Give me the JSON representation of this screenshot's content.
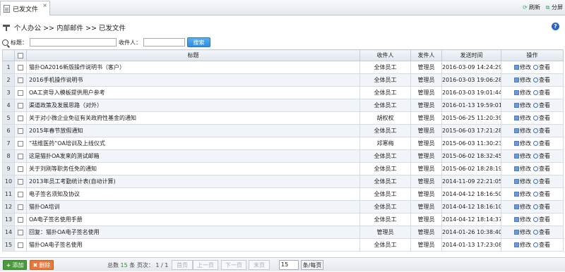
{
  "tab": {
    "title": "已发文件",
    "close": "×"
  },
  "top_actions": {
    "refresh": "刷新",
    "split": "分屏"
  },
  "breadcrumb": "个人办公 >> 内部邮件 >> 已发文件",
  "help": "?",
  "search": {
    "title_label": "标题：",
    "receiver_label": "收件人：",
    "button": "搜索",
    "title_value": "",
    "receiver_value": ""
  },
  "columns": {
    "title": "标题",
    "receiver": "收件人",
    "sender": "发件人",
    "time": "发送时间",
    "ops": "操作"
  },
  "ops": {
    "edit": "修改",
    "view": "查看"
  },
  "rows": [
    {
      "n": "1",
      "title": "猫扑OA2016新版操作说明书（客户）",
      "receiver": "全体员工",
      "sender": "管理员",
      "time": "2016-03-09 14:24:29"
    },
    {
      "n": "2",
      "title": "2016手机操作说明书",
      "receiver": "全体员工",
      "sender": "管理员",
      "time": "2016-03-03 19:06:28"
    },
    {
      "n": "3",
      "title": "OA工资导入模板提供用户参考",
      "receiver": "全体员工",
      "sender": "管理员",
      "time": "2016-03-03 19:01:44"
    },
    {
      "n": "4",
      "title": "渠道政策及发展思路（对外）",
      "receiver": "全体员工",
      "sender": "管理员",
      "time": "2016-01-13 19:59:01"
    },
    {
      "n": "5",
      "title": "关于对小微企业免征有关政府性基金的通知",
      "receiver": "胡权权",
      "sender": "管理员",
      "time": "2015-06-25 11:20:39"
    },
    {
      "n": "6",
      "title": "2015年春节放假通知",
      "receiver": "全体员工",
      "sender": "管理员",
      "time": "2015-06-03 17:21:28"
    },
    {
      "n": "7",
      "title": "”祛维医药“OA培训及上线仪式",
      "receiver": "邓寒梅",
      "sender": "管理员",
      "time": "2015-06-03 11:30:23"
    },
    {
      "n": "8",
      "title": "这是猫扑OA发来的测试邮箱",
      "receiver": "全体员工",
      "sender": "管理员",
      "time": "2015-06-02 18:32:45"
    },
    {
      "n": "9",
      "title": "关于刘刚等职务任免的通知",
      "receiver": "全体员工",
      "sender": "管理员",
      "time": "2015-06-02 18:28:19"
    },
    {
      "n": "10",
      "title": "2013年员工考勤统计表(自动计算)",
      "receiver": "全体员工",
      "sender": "管理员",
      "time": "2014-11-09 22:21:05"
    },
    {
      "n": "11",
      "title": "电子签名须知及协议",
      "receiver": "全体员工",
      "sender": "管理员",
      "time": "2014-04-12 18:16:50"
    },
    {
      "n": "12",
      "title": "猫扑OA培训",
      "receiver": "全体员工",
      "sender": "管理员",
      "time": "2014-04-12 18:16:10"
    },
    {
      "n": "13",
      "title": "OA电子签名使用手册",
      "receiver": "全体员工",
      "sender": "管理员",
      "time": "2014-04-12 18:14:37"
    },
    {
      "n": "14",
      "title": "回复：猫扑OA电子签名使用",
      "receiver": "管理员",
      "sender": "管理员",
      "time": "2014-01-26 10:38:40"
    },
    {
      "n": "15",
      "title": "猫扑OA电子签名使用",
      "receiver": "全体员工",
      "sender": "管理员",
      "time": "2014-01-13 17:23:08"
    }
  ],
  "footer": {
    "add": "添加",
    "delete": "删除",
    "total_label": "总数",
    "total": "15",
    "items_label": "条 页次：",
    "page": "1 / 1",
    "first": "首页",
    "prev": "上一页",
    "next": "下一页",
    "last": "末页",
    "page_size": "15",
    "per_page": "条/每页"
  }
}
